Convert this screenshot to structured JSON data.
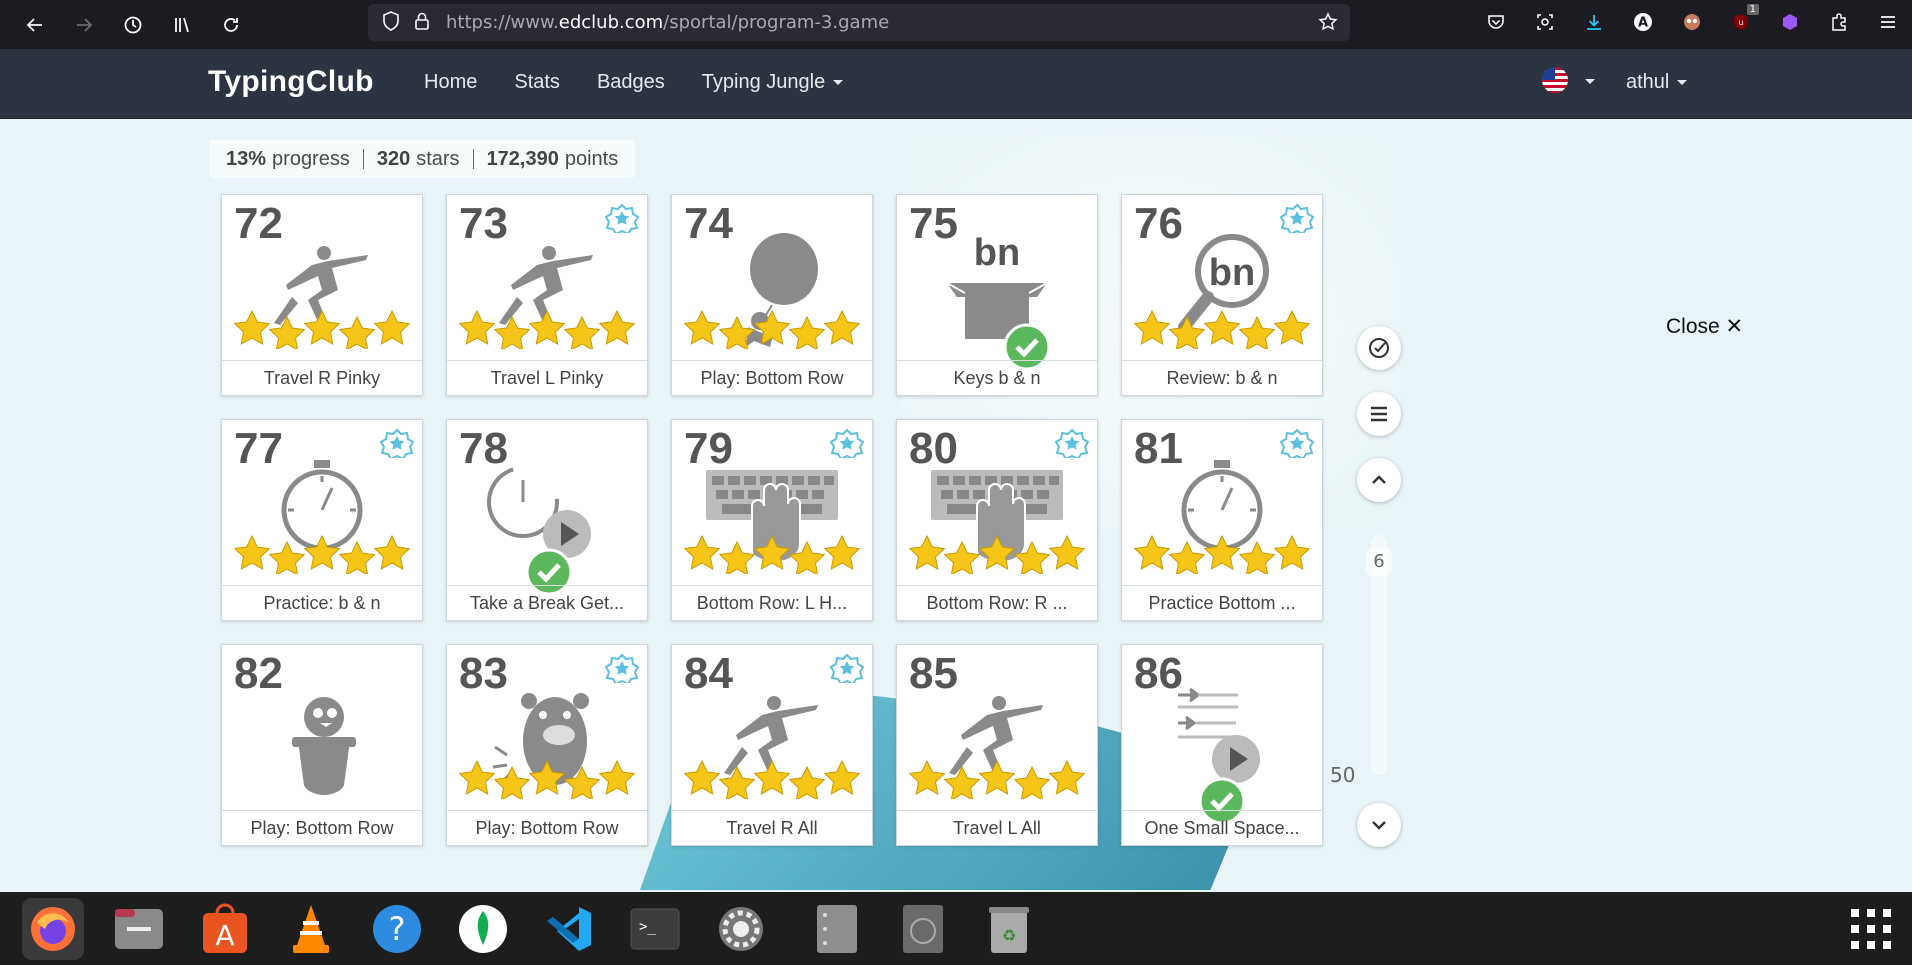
{
  "browser": {
    "url_prefix": "https://www.",
    "url_domain": "edclub.com",
    "url_path": "/sportal/program-3.game",
    "download_badge": "1"
  },
  "site": {
    "brand": "TypingClub",
    "nav": [
      "Home",
      "Stats",
      "Badges",
      "Typing Jungle"
    ],
    "user": "athul"
  },
  "progress": {
    "percent": "13%",
    "percent_label": "progress",
    "stars": "320",
    "stars_label": "stars",
    "points": "172,390",
    "points_label": "points"
  },
  "cards": [
    {
      "num": "72",
      "label": "Travel R Pinky",
      "art": "yoga-figure",
      "stars": 5,
      "badge": false,
      "check": false
    },
    {
      "num": "73",
      "label": "Travel L Pinky",
      "art": "yoga-figure",
      "stars": 5,
      "badge": true,
      "check": false
    },
    {
      "num": "74",
      "label": "Play: Bottom Row",
      "art": "balloon-monkey",
      "stars": 5,
      "badge": false,
      "check": false
    },
    {
      "num": "75",
      "label": "Keys b & n",
      "art": "box-bn",
      "stars": 0,
      "badge": false,
      "check": true
    },
    {
      "num": "76",
      "label": "Review: b & n",
      "art": "magnifier-bn",
      "stars": 5,
      "badge": true,
      "check": false
    },
    {
      "num": "77",
      "label": "Practice: b & n",
      "art": "stopwatch",
      "stars": 5,
      "badge": true,
      "check": false
    },
    {
      "num": "78",
      "label": "Take a Break Get...",
      "art": "clock-video",
      "stars": 0,
      "badge": false,
      "check": true
    },
    {
      "num": "79",
      "label": "Bottom Row: L H...",
      "art": "keyboard-hand",
      "stars": 5,
      "badge": true,
      "check": false
    },
    {
      "num": "80",
      "label": "Bottom Row: R ...",
      "art": "keyboard-hand",
      "stars": 5,
      "badge": true,
      "check": false
    },
    {
      "num": "81",
      "label": "Practice Bottom ...",
      "art": "stopwatch",
      "stars": 5,
      "badge": true,
      "check": false
    },
    {
      "num": "82",
      "label": "Play: Bottom Row",
      "art": "bird-pot",
      "stars": 0,
      "badge": false,
      "check": false
    },
    {
      "num": "83",
      "label": "Play: Bottom Row",
      "art": "bear",
      "stars": 5,
      "badge": true,
      "check": false
    },
    {
      "num": "84",
      "label": "Travel R All",
      "art": "yoga-figure",
      "stars": 5,
      "badge": true,
      "check": false
    },
    {
      "num": "85",
      "label": "Travel L All",
      "art": "yoga-figure",
      "stars": 5,
      "badge": false,
      "check": false
    },
    {
      "num": "86",
      "label": "One Small Space...",
      "art": "tabs-video",
      "stars": 0,
      "badge": false,
      "check": true
    }
  ],
  "side": {
    "close_label": "Close",
    "page_current": "6",
    "page_max": "50"
  },
  "colors": {
    "navbar": "#2b3440",
    "star": "#f5c518",
    "badge": "#5bc0de",
    "check": "#5cb85c"
  }
}
